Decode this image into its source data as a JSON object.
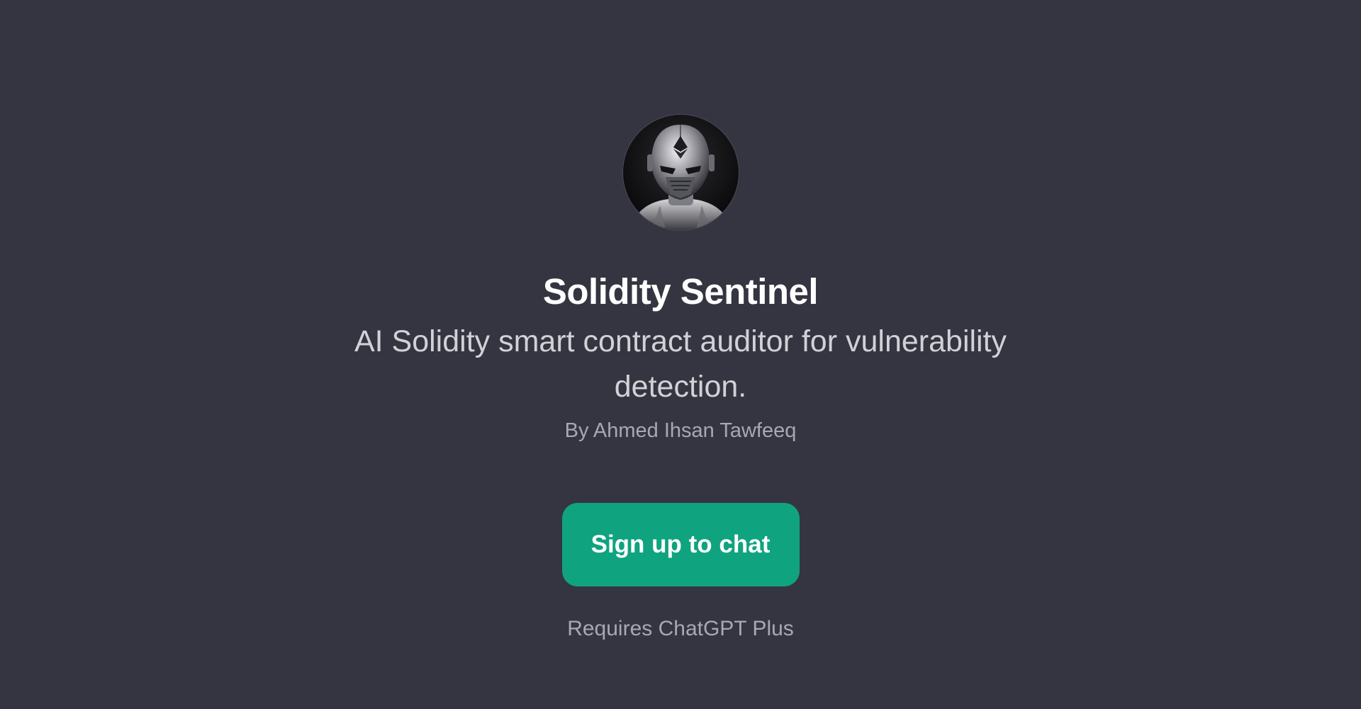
{
  "gpt": {
    "name": "Solidity Sentinel",
    "description": "AI Solidity smart contract auditor for vulnerability detection.",
    "author": "By Ahmed Ihsan Tawfeeq",
    "avatar_icon": "chrome-robot-ethereum-avatar"
  },
  "actions": {
    "signup_label": "Sign up to chat",
    "requirement_note": "Requires ChatGPT Plus"
  },
  "colors": {
    "background": "#343541",
    "accent": "#10a37f",
    "title": "#ffffff",
    "subtitle": "#d1d1d6",
    "muted": "#a8a8b3"
  }
}
